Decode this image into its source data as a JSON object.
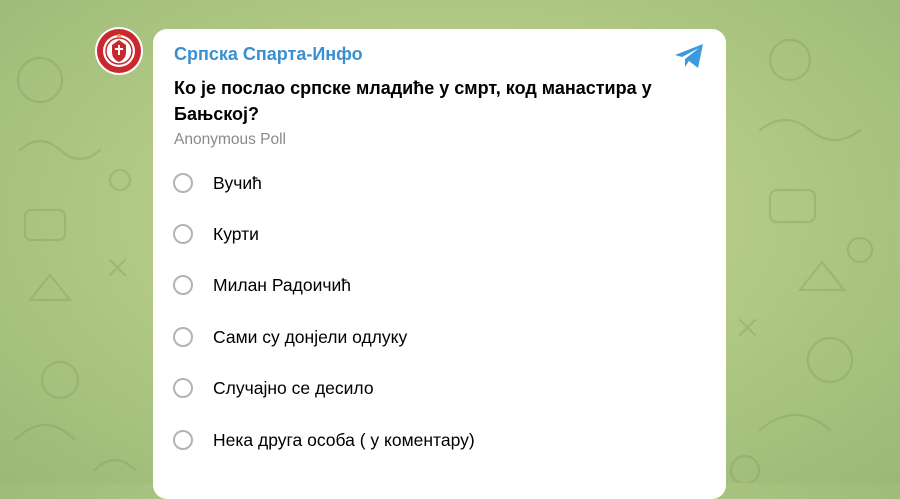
{
  "message": {
    "channel_name": "Српска Спарта-Инфо",
    "question": "Ко је послао српске младиће у смрт, код манастира у Бањској?",
    "poll_type": "Anonymous Poll",
    "options": [
      {
        "label": "Вучић"
      },
      {
        "label": "Курти"
      },
      {
        "label": "Милан Радоичић"
      },
      {
        "label": "Сами су донјели одлуку"
      },
      {
        "label": "Случајно се десило"
      },
      {
        "label": "Нека друга особа ( у коментару)"
      }
    ]
  },
  "icons": {
    "avatar": "channel-emblem-icon",
    "share": "telegram-plane-icon",
    "option_marker": "radio-circle-icon"
  },
  "colors": {
    "background": "#b3cb86",
    "channel_name": "#3a8fd1",
    "telegram_icon": "#3a9be0",
    "radio_border": "#aeb4b8",
    "muted_text": "#8a8a8a",
    "emblem_red": "#c8282e"
  }
}
